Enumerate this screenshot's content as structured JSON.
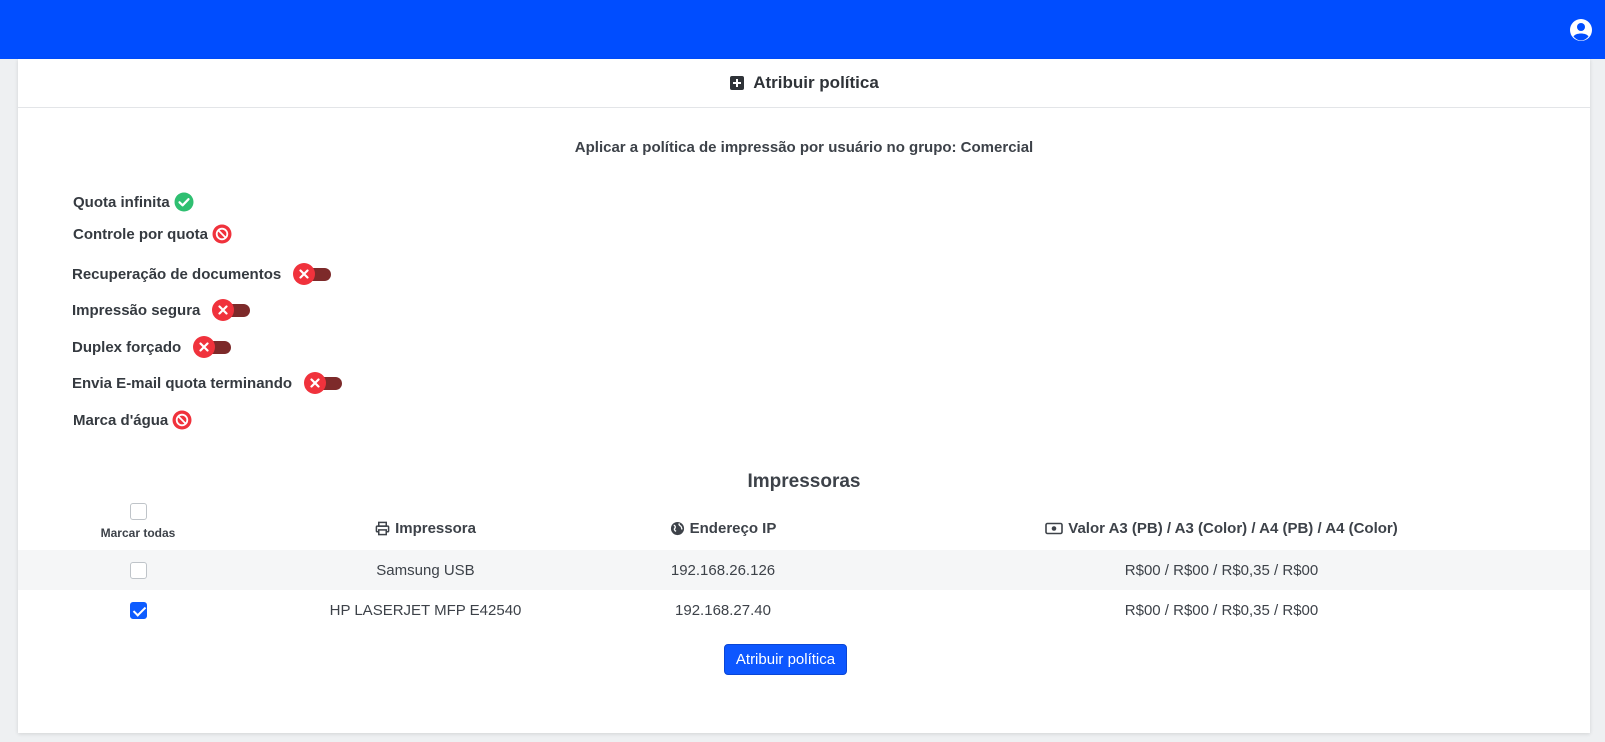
{
  "header": {
    "title": "Atribuir política"
  },
  "subtitle": "Aplicar a política de impressão por usuário no grupo: Comercial",
  "options": {
    "quota_infinita": "Quota infinita",
    "controle_quota": "Controle por quota",
    "recuperacao": "Recuperação de documentos",
    "impressao_segura": "Impressão segura",
    "duplex": "Duplex forçado",
    "email_quota": "Envia E-mail quota terminando",
    "marca_dagua": "Marca d'água"
  },
  "printers_section": {
    "title": "Impressoras",
    "check_all_label": "Marcar todas",
    "columns": {
      "printer": "Impressora",
      "ip": "Endereço IP",
      "value": "Valor A3 (PB) / A3 (Color) / A4 (PB) / A4 (Color)"
    },
    "rows": [
      {
        "name": "Samsung USB",
        "ip": "192.168.26.126",
        "value": "R$00 / R$00 / R$0,35 / R$00",
        "checked": false
      },
      {
        "name": "HP LASERJET MFP E42540",
        "ip": "192.168.27.40",
        "value": "R$00 / R$00 / R$0,35 / R$00",
        "checked": true
      }
    ]
  },
  "assign_button": "Atribuir política",
  "colors": {
    "topbar": "#004dff",
    "success": "#2fbf71",
    "danger": "#f0323c",
    "primary_button": "#0d57ff"
  }
}
